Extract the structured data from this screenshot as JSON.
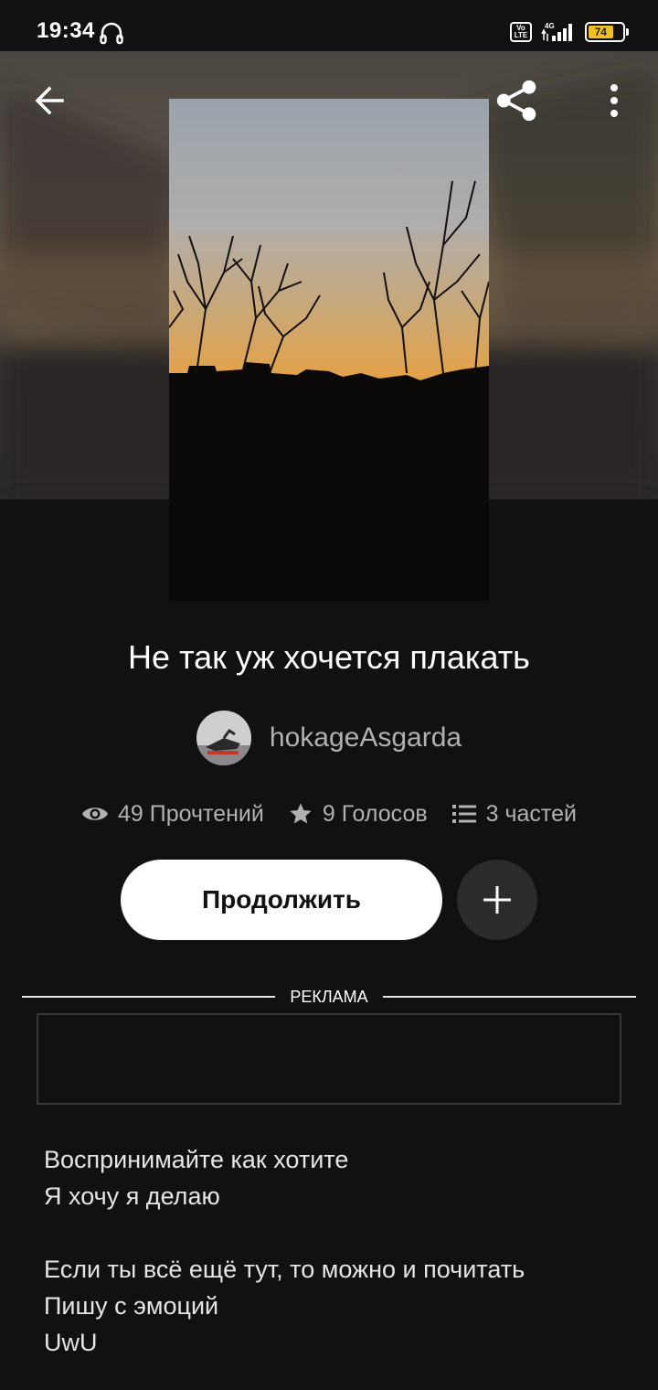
{
  "status_bar": {
    "time": "19:34",
    "volte_label": "Vo LTE",
    "network": "4G",
    "battery": "74"
  },
  "story": {
    "title": "Не так уж хочется плакать",
    "author": "hokageAsgarda"
  },
  "stats": {
    "reads": "49 Прочтений",
    "votes": "9 Голосов",
    "parts": "3 частей"
  },
  "actions": {
    "continue_label": "Продолжить"
  },
  "ad": {
    "label": "РЕКЛАМА"
  },
  "description": [
    "Воспринимайте как хотите",
    "Я хочу я делаю",
    "",
    "Если ты всё ещё тут, то можно и почитать",
    "Пишу с эмоций",
    "UwU"
  ],
  "colors": {
    "background": "#121012",
    "muted_text": "#b3b0b3",
    "button_light": "#ffffff",
    "button_dark": "#2d2b2e",
    "battery": "#f0c020"
  },
  "icons": [
    "back-arrow-icon",
    "share-icon",
    "more-vertical-icon",
    "eye-icon",
    "star-icon",
    "list-icon",
    "plus-icon",
    "headset-icon"
  ]
}
